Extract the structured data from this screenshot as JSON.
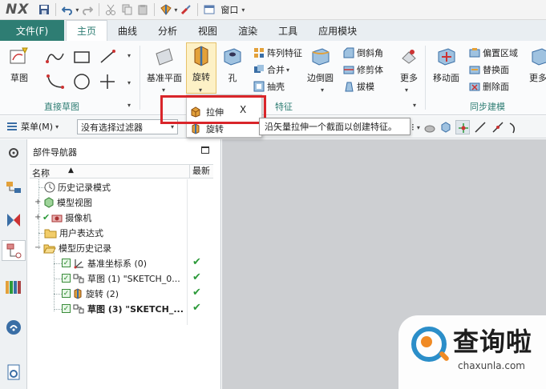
{
  "titlebar": {
    "logo": "NX",
    "quick_access": [
      "save-icon",
      "undo-icon",
      "redo-icon",
      "cut-icon",
      "copy-icon",
      "paste-icon",
      "feature-icon",
      "brush-icon"
    ],
    "window_menu": "窗口",
    "window_caret": "▾"
  },
  "tabs": {
    "file": "文件(F)",
    "items": [
      "主页",
      "曲线",
      "分析",
      "视图",
      "渲染",
      "工具",
      "应用模块"
    ],
    "active": "主页"
  },
  "ribbon": {
    "sketch": "草图",
    "direct_sketch_group": "直接草图",
    "datum_plane": "基准平面",
    "revolve": "旋转",
    "hole": "孔",
    "pattern_feature": "阵列特征",
    "unite": "合并",
    "shell": "抽壳",
    "feature_group": "特征",
    "edge_blend": "边倒圆",
    "chamfer": "倒斜角",
    "trim_body": "修剪体",
    "draft": "拔模",
    "more": "更多",
    "move_face": "移动面",
    "offset_region": "偏置区域",
    "replace_face": "替换面",
    "delete_face": "删除面",
    "sync_group": "同步建模",
    "more2": "更多"
  },
  "toolbar2": {
    "menu": "菜单(M)",
    "menu_caret": "▾",
    "filter": "没有选择过滤器",
    "filter_caret": "▾"
  },
  "popup": {
    "extrude": "拉伸",
    "close": "X",
    "revolve": "旋转",
    "tooltip": "沿矢量拉伸一个截面以创建特征。"
  },
  "navigator": {
    "title": "部件导航器",
    "col_name": "名称",
    "sort_indicator": "▲",
    "col_latest": "最新",
    "rows": [
      {
        "label": "历史记录模式",
        "icon": "clock-icon"
      },
      {
        "label": "模型视图",
        "icon": "model-views-icon"
      },
      {
        "label": "摄像机",
        "icon": "camera-icon"
      },
      {
        "label": "用户表达式",
        "icon": "folder-icon"
      },
      {
        "label": "模型历史记录",
        "icon": "folder-open-icon"
      },
      {
        "label": "基准坐标系 (0)",
        "icon": "datum-csys-icon",
        "latest": "✔"
      },
      {
        "label": "草图 (1) \"SKETCH_0...",
        "icon": "sketch-icon",
        "latest": "✔"
      },
      {
        "label": "旋转 (2)",
        "icon": "revolve-icon",
        "latest": "✔"
      },
      {
        "label": "草图 (3) \"SKETCH_...",
        "icon": "sketch-icon",
        "latest": "✔"
      }
    ]
  },
  "watermark": {
    "cn": "查询啦",
    "en": "chaxunla.com"
  },
  "colors": {
    "accent": "#2e7d73",
    "highlight_border": "#d9252a",
    "check": "#2c9a3a",
    "graphics_bg": "#cdcfd2"
  }
}
